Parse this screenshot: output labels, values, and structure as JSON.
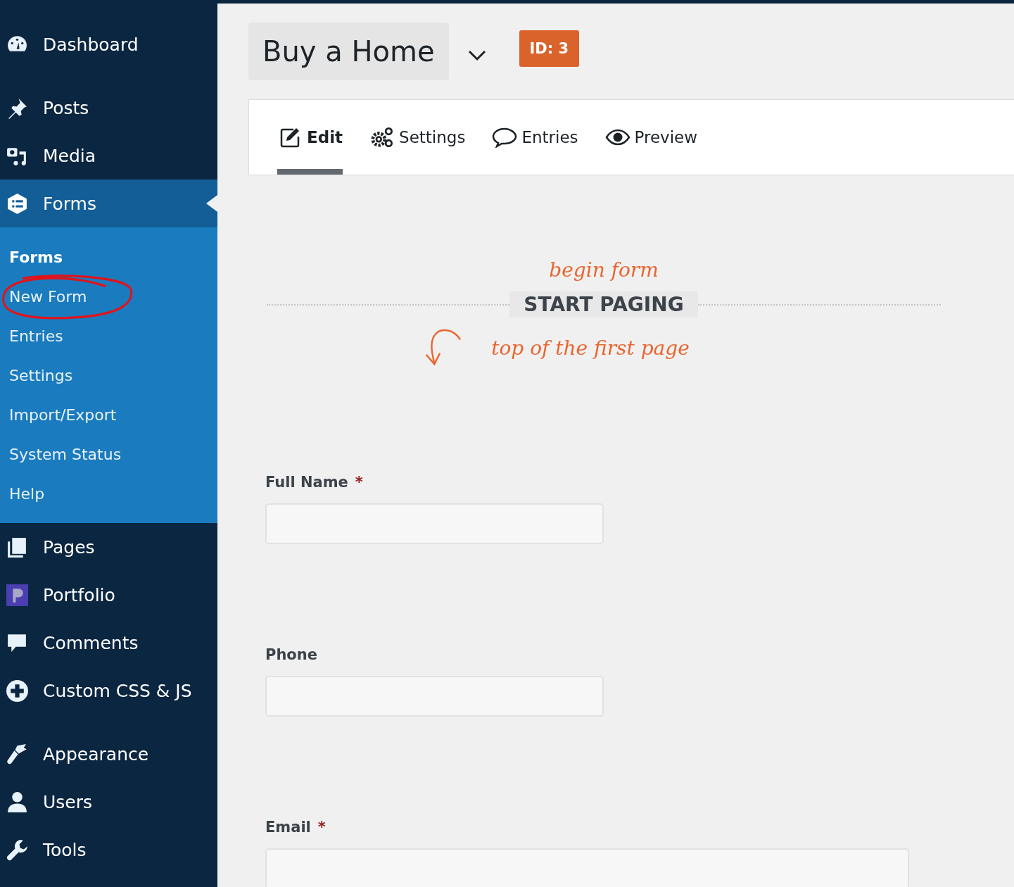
{
  "sidebar": {
    "menu": [
      {
        "label": "Dashboard",
        "selected": false
      },
      {
        "label": "Posts",
        "selected": false
      },
      {
        "label": "Media",
        "selected": false
      },
      {
        "label": "Forms",
        "selected": true,
        "submenu": [
          {
            "label": "Forms",
            "selected": true,
            "circled": false
          },
          {
            "label": "New Form",
            "selected": false,
            "circled": true
          },
          {
            "label": "Entries",
            "selected": false,
            "circled": false
          },
          {
            "label": "Settings",
            "selected": false,
            "circled": false
          },
          {
            "label": "Import/Export",
            "selected": false,
            "circled": false
          },
          {
            "label": "System Status",
            "selected": false,
            "circled": false
          },
          {
            "label": "Help",
            "selected": false,
            "circled": false
          }
        ]
      },
      {
        "label": "Pages",
        "selected": false
      },
      {
        "label": "Portfolio",
        "selected": false
      },
      {
        "label": "Comments",
        "selected": false
      },
      {
        "label": "Custom CSS & JS",
        "selected": false
      },
      {
        "label": "Appearance",
        "selected": false
      },
      {
        "label": "Users",
        "selected": false
      },
      {
        "label": "Tools",
        "selected": false
      }
    ]
  },
  "header": {
    "form_title": "Buy a Home",
    "id_badge": "ID: 3"
  },
  "tabs": [
    {
      "label": "Edit",
      "selected": true
    },
    {
      "label": "Settings",
      "selected": false
    },
    {
      "label": "Entries",
      "selected": false
    },
    {
      "label": "Preview",
      "selected": false
    }
  ],
  "paging": {
    "note_above": "begin form",
    "label": "START PAGING",
    "note_below": "top of the first page"
  },
  "fields": [
    {
      "label": "Full Name",
      "required_mark": "*",
      "kind": "text"
    },
    {
      "label": "Phone",
      "kind": "text"
    },
    {
      "label": "Email",
      "required_mark": "*",
      "kind": "wide"
    }
  ]
}
